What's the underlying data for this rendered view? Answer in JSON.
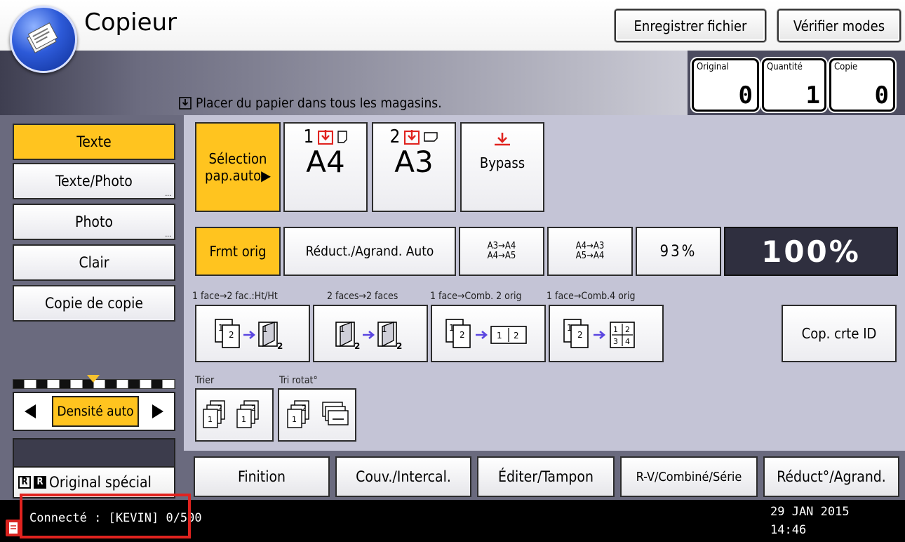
{
  "header": {
    "app_title": "Copieur",
    "save_file_label": "Enregistrer fichier",
    "check_modes_label": "Vérifier modes",
    "message": "Placer du papier dans tous les magasins.",
    "counters": [
      {
        "label": "Original",
        "value": "0"
      },
      {
        "label": "Quantité",
        "value": "1"
      },
      {
        "label": "Copie",
        "value": "0"
      }
    ]
  },
  "sidebar": {
    "items": [
      {
        "label": "Texte",
        "selected": true
      },
      {
        "label": "Texte/Photo",
        "selected": false
      },
      {
        "label": "Photo",
        "selected": false
      },
      {
        "label": "Clair",
        "selected": false
      },
      {
        "label": "Copie de copie",
        "selected": false
      }
    ],
    "more_dots": "...",
    "density_label": "Densité auto",
    "special_label": "Original spécial",
    "special_icon_text": [
      "R",
      "R"
    ]
  },
  "paper": {
    "auto_label_line1": "Sélection",
    "auto_label_line2": "pap.auto▶",
    "tray1_num": "1",
    "tray1_size": "A4",
    "tray2_num": "2",
    "tray2_size": "A3",
    "bypass_label": "Bypass"
  },
  "ratio": {
    "orig_format_label": "Frmt orig",
    "auto_reduce_label": "Réduct./Agrand. Auto",
    "preset1_line1": "A3→A4",
    "preset1_line2": "A4→A5",
    "preset2_line1": "A4→A3",
    "preset2_line2": "A5→A4",
    "preset3": "93%",
    "current": "100%"
  },
  "duplex": {
    "labels": [
      "1 face→2 fac.:Ht/Ht",
      "2 faces→2 faces",
      "1 face→Comb. 2 orig",
      "1 face→Comb.4 orig"
    ],
    "id_card_label": "Cop. crte ID"
  },
  "sort": {
    "sort_label": "Trier",
    "rotate_sort_label": "Tri rotat°"
  },
  "tabs": [
    "Finition",
    "Couv./Intercal.",
    "Éditer/Tampon",
    "R-V/Combiné/Série",
    "Réduct°/Agrand."
  ],
  "status": {
    "connected": "Connecté : [KEVIN] 0/500",
    "date": "29 JAN  2015",
    "time": "14:46"
  },
  "colors": {
    "selected": "#ffc41f",
    "highlight_frame": "#e0231f",
    "tray_icon": "#e0231f",
    "arrow": "#5b46e0"
  }
}
